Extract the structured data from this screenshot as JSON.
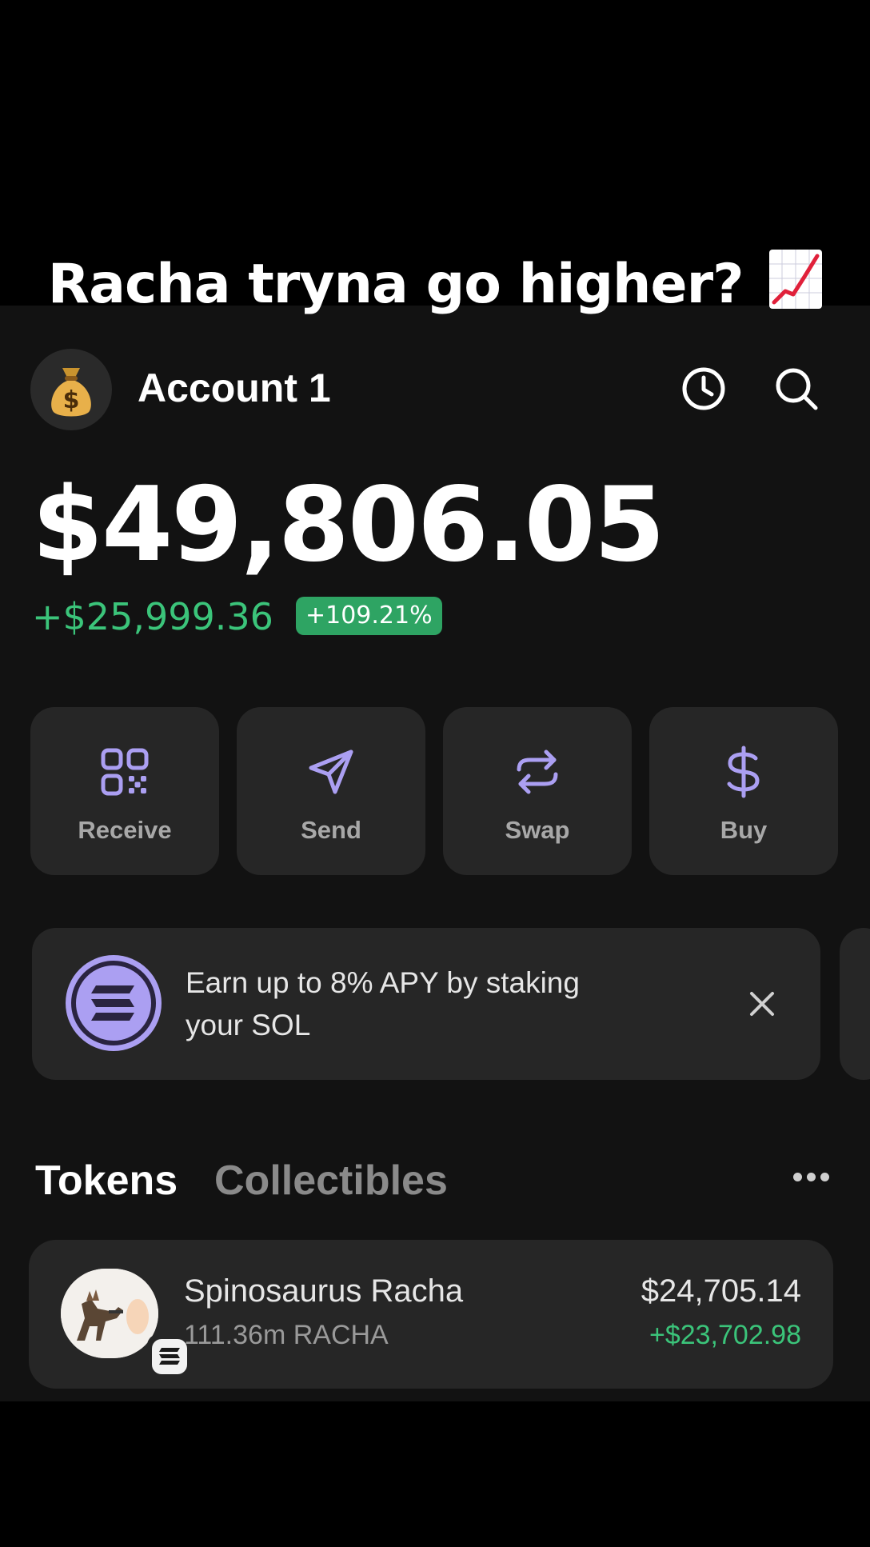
{
  "caption": {
    "text": "Racha tryna go higher?",
    "emoji": "chart-increasing-icon"
  },
  "header": {
    "avatar_icon": "money-bag-icon",
    "account_name": "Account 1"
  },
  "portfolio": {
    "balance": "$49,806.05",
    "change_amount": "+$25,999.36",
    "change_percent": "+109.21%"
  },
  "actions": [
    {
      "label": "Receive",
      "icon": "qr-code-icon"
    },
    {
      "label": "Send",
      "icon": "send-icon"
    },
    {
      "label": "Swap",
      "icon": "swap-icon"
    },
    {
      "label": "Buy",
      "icon": "dollar-icon"
    }
  ],
  "banner": {
    "text": "Earn up to 8% APY by staking your SOL",
    "icon": "solana-icon"
  },
  "tabs": {
    "active": "Tokens",
    "inactive": "Collectibles"
  },
  "tokens": [
    {
      "name": "Spinosaurus Racha",
      "amount": "111.36m RACHA",
      "value": "$24,705.14",
      "change": "+$23,702.98"
    }
  ],
  "colors": {
    "accent": "#ab9ff2",
    "positive": "#3bc47a",
    "badge": "#2ea463",
    "card": "#262626",
    "background": "#121212"
  }
}
